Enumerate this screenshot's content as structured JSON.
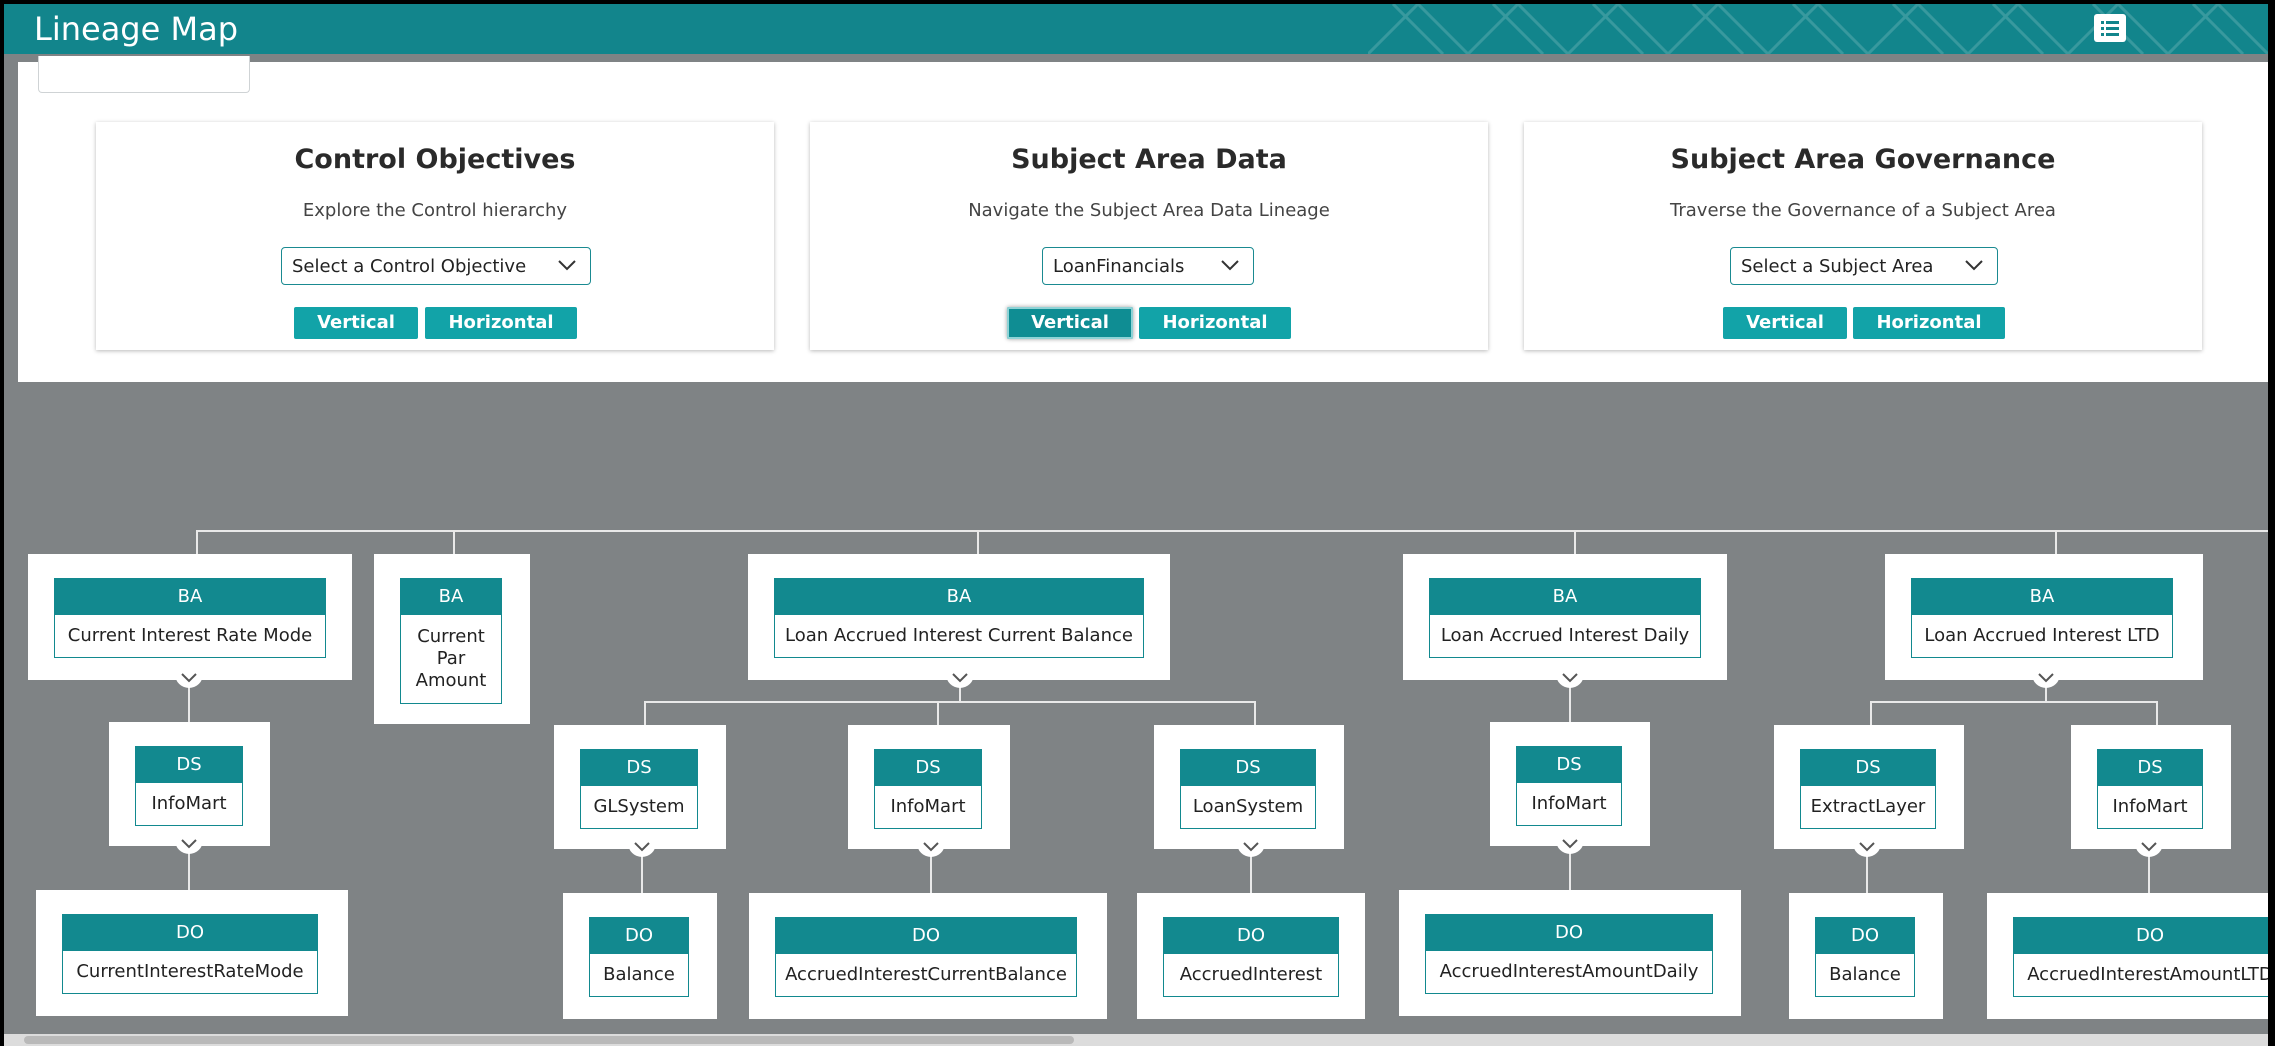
{
  "header": {
    "title": "Lineage Map",
    "menu_icon": "list-icon"
  },
  "panel": {
    "cards": [
      {
        "title": "Control Objectives",
        "description": "Explore the Control hierarchy",
        "select_value": "Select a Control Objective",
        "vertical_label": "Vertical",
        "horizontal_label": "Horizontal"
      },
      {
        "title": "Subject Area Data",
        "description": "Navigate the Subject Area Data Lineage",
        "select_value": "LoanFinancials",
        "vertical_label": "Vertical",
        "horizontal_label": "Horizontal"
      },
      {
        "title": "Subject Area Governance",
        "description": "Traverse the Governance of a Subject Area",
        "select_value": "Select a Subject Area",
        "vertical_label": "Vertical",
        "horizontal_label": "Horizontal"
      }
    ]
  },
  "tree": {
    "nodes": [
      {
        "type": "BA",
        "label": "Current Interest Rate Mode"
      },
      {
        "type": "BA",
        "label": "Current Par Amount"
      },
      {
        "type": "BA",
        "label": "Loan Accrued Interest Current Balance"
      },
      {
        "type": "BA",
        "label": "Loan Accrued Interest Daily"
      },
      {
        "type": "BA",
        "label": "Loan Accrued Interest LTD"
      },
      {
        "type": "DS",
        "label": "InfoMart"
      },
      {
        "type": "DS",
        "label": "GLSystem"
      },
      {
        "type": "DS",
        "label": "InfoMart"
      },
      {
        "type": "DS",
        "label": "LoanSystem"
      },
      {
        "type": "DS",
        "label": "InfoMart"
      },
      {
        "type": "DS",
        "label": "ExtractLayer"
      },
      {
        "type": "DS",
        "label": "InfoMart"
      },
      {
        "type": "DO",
        "label": "CurrentInterestRateMode"
      },
      {
        "type": "DO",
        "label": "Balance"
      },
      {
        "type": "DO",
        "label": "AccruedInterestCurrentBalance"
      },
      {
        "type": "DO",
        "label": "AccruedInterest"
      },
      {
        "type": "DO",
        "label": "AccruedInterestAmountDaily"
      },
      {
        "type": "DO",
        "label": "Balance"
      },
      {
        "type": "DO",
        "label": "AccruedInterestAmountLTD"
      }
    ]
  },
  "colors": {
    "header": "#12858c",
    "teal": "#12898f",
    "button": "#12a3a8",
    "canvas": "#7f8385"
  }
}
